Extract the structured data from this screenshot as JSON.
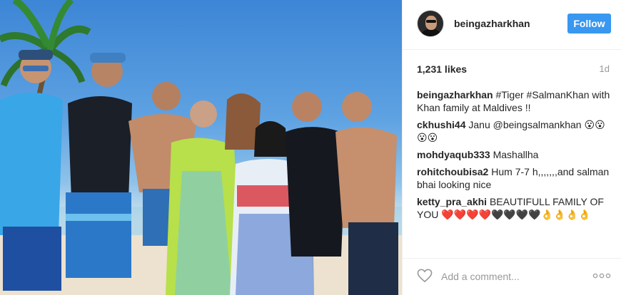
{
  "colors": {
    "follow_bg": "#3897f0",
    "text": "#262626",
    "muted": "#999999",
    "border": "#efefef"
  },
  "header": {
    "username": "beingazharkhan",
    "follow_label": "Follow",
    "avatar_icon": "profile-avatar"
  },
  "stats": {
    "likes": "1,231 likes",
    "time": "1d"
  },
  "comments": [
    {
      "user": "beingazharkhan",
      "text": " #Tiger #SalmanKhan with Khan family at Maldives !!"
    },
    {
      "user": "ckhushi44",
      "text": " Janu @beingsalmankhan 😮😮😮😮"
    },
    {
      "user": "mohdyaqub333",
      "text": " Mashallha"
    },
    {
      "user": "rohitchoubisa2",
      "text": " Hum 7-7 h,,,,,,,and salman bhai looking nice"
    },
    {
      "user": "ketty_pra_akhi",
      "text": " BEAUTIFULL FAMILY OF YOU ❤️❤️❤️❤️🖤🖤🖤🖤👌👌👌👌"
    }
  ],
  "footer": {
    "placeholder": "Add a comment...",
    "like_icon": "heart-icon",
    "more_icon": "more-options-icon"
  },
  "photo": {
    "description_icon": "post-photo"
  }
}
